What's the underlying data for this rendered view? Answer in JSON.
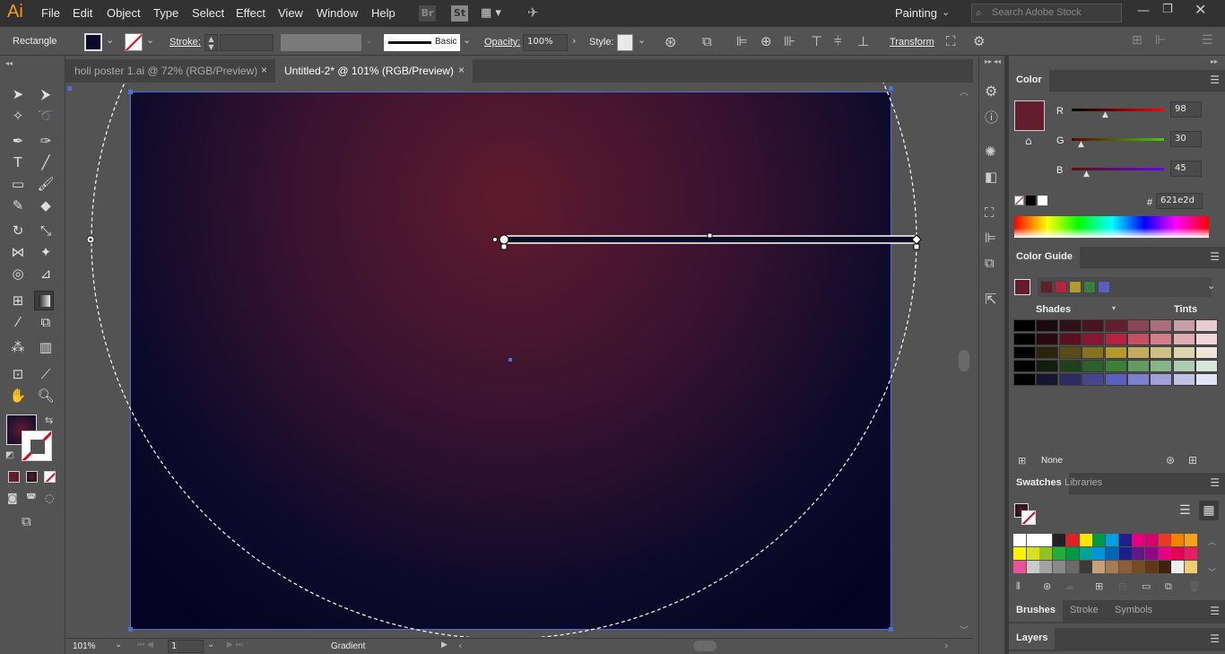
{
  "app": {
    "logo": "Ai",
    "workspace": "Painting",
    "search_placeholder": "Search Adobe Stock",
    "br": "Br",
    "st": "St"
  },
  "menu": [
    "File",
    "Edit",
    "Object",
    "Type",
    "Select",
    "Effect",
    "View",
    "Window",
    "Help"
  ],
  "control": {
    "tool_name": "Rectangle",
    "stroke_label": "Stroke:",
    "brush_label": "Basic",
    "opacity_label": "Opacity:",
    "opacity_value": "100%",
    "style_label": "Style:",
    "transform_label": "Transform"
  },
  "tabs": [
    {
      "label": "holi poster 1.ai @ 72% (RGB/Preview)",
      "close": "×"
    },
    {
      "label": "Untitled-2* @ 101% (RGB/Preview)",
      "close": "×"
    }
  ],
  "status": {
    "zoom": "101%",
    "page": "1",
    "tool": "Gradient"
  },
  "color_panel": {
    "title": "Color",
    "r_label": "R",
    "g_label": "G",
    "b_label": "B",
    "r": "98",
    "g": "30",
    "b": "45",
    "hex_label": "#",
    "hex": "621e2d",
    "swatch": "#621e2d"
  },
  "color_guide": {
    "title": "Color Guide",
    "shades": "Shades",
    "tints": "Tints",
    "none": "None",
    "harmony": [
      "#621e2d",
      "#b8213f",
      "#b29a2c",
      "#3a7f3a",
      "#5a5fc0"
    ]
  },
  "swatches_panel": {
    "tabs": [
      "Swatches",
      "Libraries"
    ]
  },
  "bottom_tabs": [
    "Brushes",
    "Stroke",
    "Symbols"
  ],
  "layers": "Layers",
  "colors": {
    "accent": "#4a6fd8",
    "fill": "#621e2d",
    "gradient_center": "#5f1b2d",
    "gradient_edge": "#040422"
  }
}
